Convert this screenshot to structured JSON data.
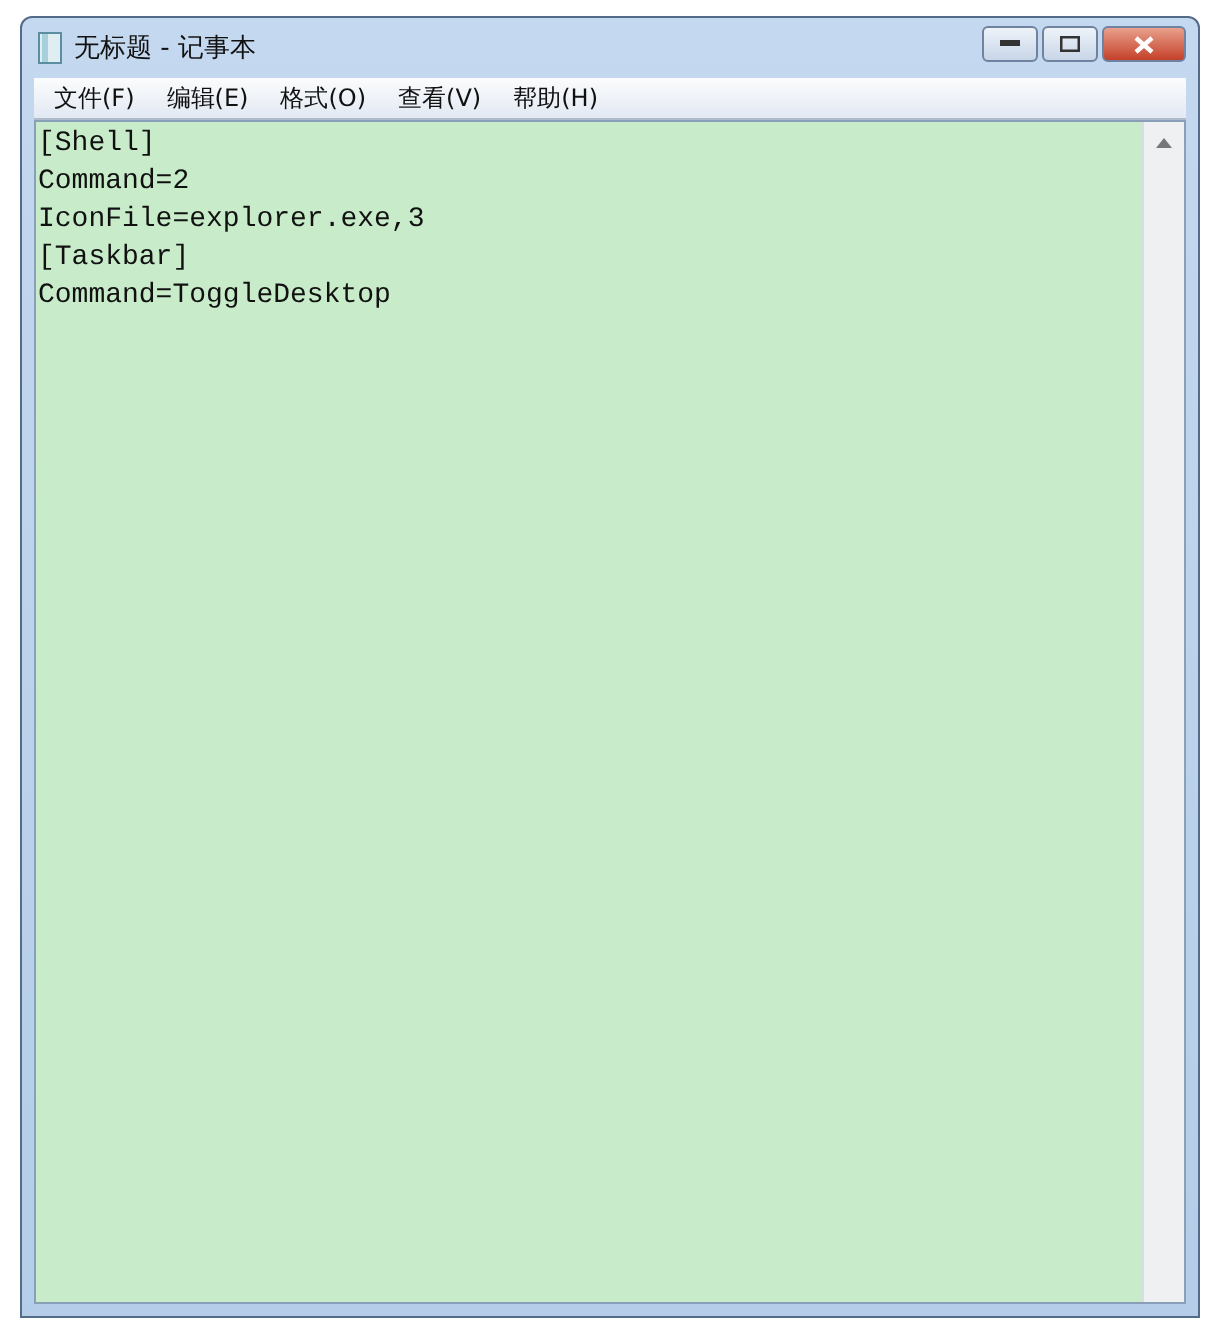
{
  "window": {
    "title": "无标题 - 记事本"
  },
  "menu": [
    "文件(F)",
    "编辑(E)",
    "格式(O)",
    "查看(V)",
    "帮助(H)"
  ],
  "editor": {
    "lines": [
      "[Shell]",
      "Command=2",
      "IconFile=explorer.exe,3",
      "[Taskbar]",
      "Command=ToggleDesktop"
    ]
  }
}
